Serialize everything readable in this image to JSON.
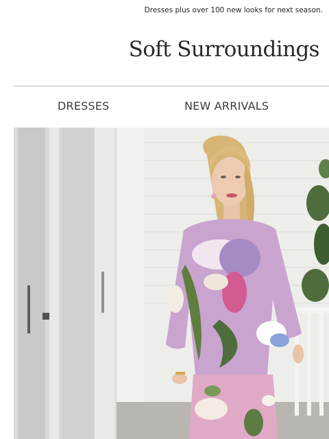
{
  "preheader": {
    "text": "Dresses plus over 100 new looks for next season."
  },
  "brand": {
    "logo_text": "Soft Surroundings"
  },
  "nav": {
    "items": [
      {
        "label": "DRESSES"
      },
      {
        "label": "NEW ARRIVALS"
      }
    ]
  },
  "hero": {
    "image_alt": "Model in lavender floral print top and pants on a porch",
    "colors": {
      "top_lavender": "#c9a4cf",
      "wall_white": "#eeeeeb",
      "door_gray": "#cfd2cf",
      "hair_blonde": "#d7b574",
      "leaf_green": "#4f6d3c"
    }
  }
}
